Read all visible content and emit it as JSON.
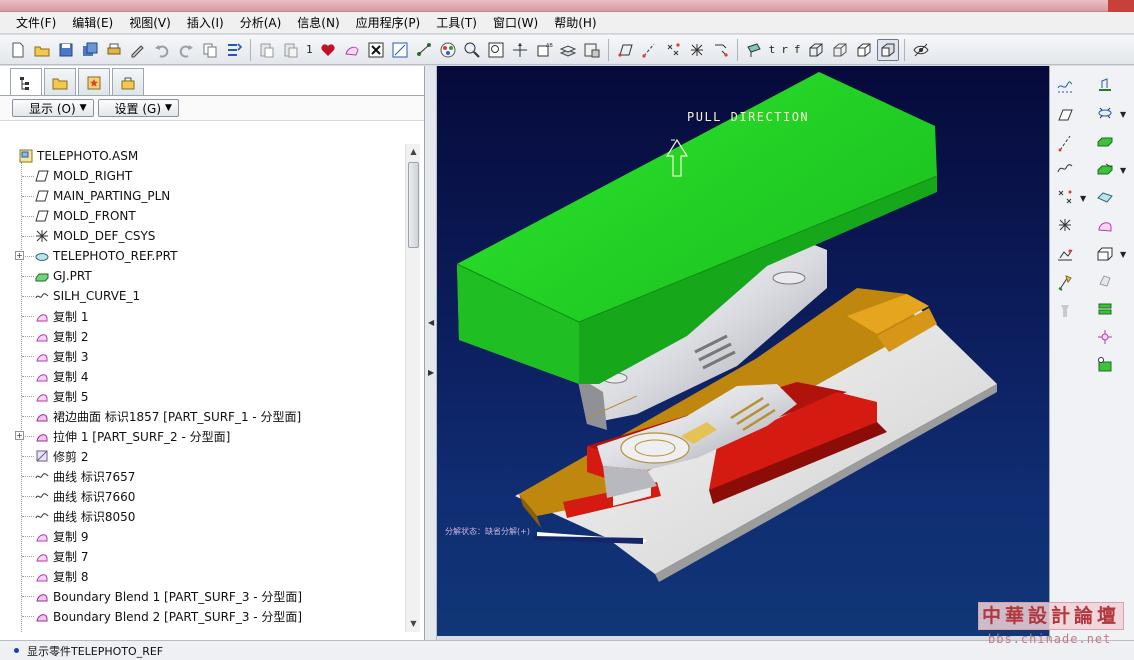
{
  "menu": [
    "文件(F)",
    "编辑(E)",
    "视图(V)",
    "插入(I)",
    "分析(A)",
    "信息(N)",
    "应用程序(P)",
    "工具(T)",
    "窗口(W)",
    "帮助(H)"
  ],
  "toolbar": {
    "repaint_count": "1",
    "view_letters": [
      "t",
      "r",
      "f"
    ]
  },
  "panel": {
    "show_label": "显示 (O)",
    "settings_label": "设置 (G)"
  },
  "tree": [
    {
      "label": "TELEPHOTO.ASM",
      "icon": "assembly-icon",
      "level": 0,
      "expandable": false
    },
    {
      "label": "MOLD_RIGHT",
      "icon": "datum-plane-icon",
      "level": 1,
      "expandable": false
    },
    {
      "label": "MAIN_PARTING_PLN",
      "icon": "datum-plane-icon",
      "level": 1,
      "expandable": false
    },
    {
      "label": "MOLD_FRONT",
      "icon": "datum-plane-icon",
      "level": 1,
      "expandable": false
    },
    {
      "label": "MOLD_DEF_CSYS",
      "icon": "csys-icon",
      "level": 1,
      "expandable": false
    },
    {
      "label": "TELEPHOTO_REF.PRT",
      "icon": "ref-part-icon",
      "level": 1,
      "expandable": true
    },
    {
      "label": "GJ.PRT",
      "icon": "workpiece-icon",
      "level": 1,
      "expandable": false
    },
    {
      "label": "SILH_CURVE_1",
      "icon": "curve-icon",
      "level": 1,
      "expandable": false
    },
    {
      "label": "复制 1",
      "icon": "copy-surface-icon",
      "level": 1,
      "expandable": false
    },
    {
      "label": "复制 2",
      "icon": "copy-surface-icon",
      "level": 1,
      "expandable": false
    },
    {
      "label": "复制 3",
      "icon": "copy-surface-icon",
      "level": 1,
      "expandable": false
    },
    {
      "label": "复制 4",
      "icon": "copy-surface-icon",
      "level": 1,
      "expandable": false
    },
    {
      "label": "复制 5",
      "icon": "copy-surface-icon",
      "level": 1,
      "expandable": false
    },
    {
      "label": "裙边曲面 标识1857 [PART_SURF_1 - 分型面]",
      "icon": "parting-surface-icon",
      "level": 1,
      "expandable": false
    },
    {
      "label": "拉伸 1 [PART_SURF_2 - 分型面]",
      "icon": "parting-surface-icon",
      "level": 1,
      "expandable": true
    },
    {
      "label": "修剪 2",
      "icon": "trim-icon",
      "level": 1,
      "expandable": false
    },
    {
      "label": "曲线 标识7657",
      "icon": "curve-icon",
      "level": 1,
      "expandable": false
    },
    {
      "label": "曲线 标识7660",
      "icon": "curve-icon",
      "level": 1,
      "expandable": false
    },
    {
      "label": "曲线 标识8050",
      "icon": "curve-icon",
      "level": 1,
      "expandable": false
    },
    {
      "label": "复制 9",
      "icon": "copy-surface-icon",
      "level": 1,
      "expandable": false
    },
    {
      "label": "复制 7",
      "icon": "copy-surface-icon",
      "level": 1,
      "expandable": false
    },
    {
      "label": "复制 8",
      "icon": "copy-surface-icon",
      "level": 1,
      "expandable": false
    },
    {
      "label": "Boundary Blend 1 [PART_SURF_3 - 分型面]",
      "icon": "parting-surface-icon",
      "level": 1,
      "expandable": false
    },
    {
      "label": "Boundary Blend 2 [PART_SURF_3 - 分型面]",
      "icon": "parting-surface-icon",
      "level": 1,
      "expandable": false
    }
  ],
  "viewport": {
    "pull_direction_label": "PULL DIRECTION",
    "small_status": "分解状态：缺省分解(+)"
  },
  "colors": {
    "upper_mold": "#19c51e",
    "part": "#e9eaee",
    "slider": "#d51a12",
    "lower_mold": "#c0870e",
    "mold_base": "#e2e2e2"
  },
  "status": {
    "message": "显示零件TELEPHOTO_REF"
  },
  "watermark": {
    "title": "中華設計論壇",
    "url": "bbs.chinade.net"
  }
}
